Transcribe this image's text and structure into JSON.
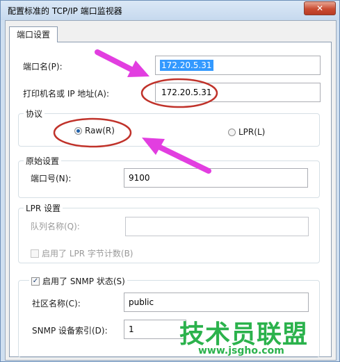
{
  "window": {
    "title": "配置标准的 TCP/IP 端口监视器",
    "close_label": "✕"
  },
  "tabs": [
    {
      "label": "端口设置"
    }
  ],
  "port_name": {
    "label": "端口名(P):",
    "value": "172.20.5.31"
  },
  "printer_address": {
    "label": "打印机名或 IP 地址(A):",
    "value": "172.20.5.31"
  },
  "protocol": {
    "title": "协议",
    "options": [
      {
        "label": "Raw(R)",
        "selected": true
      },
      {
        "label": "LPR(L)",
        "selected": false
      }
    ]
  },
  "raw_settings": {
    "title": "原始设置",
    "port_number_label": "端口号(N):",
    "port_number_value": "9100"
  },
  "lpr_settings": {
    "title": "LPR 设置",
    "queue_name_label": "队列名称(Q):",
    "queue_name_value": "",
    "byte_counting_label": "启用了 LPR 字节计数(B)",
    "byte_counting_checked": false
  },
  "snmp": {
    "enabled_label": "启用了 SNMP 状态(S)",
    "enabled_checked": true,
    "community_label": "社区名称(C):",
    "community_value": "public",
    "device_index_label": "SNMP 设备索引(D):",
    "device_index_value": "1"
  },
  "watermark": {
    "brand_text": "技术员联盟",
    "url": "www.jsgho.com"
  },
  "colors": {
    "annotation_arrow": "#e23ee0",
    "annotation_ellipse": "#c0322a",
    "watermark": "#2bb24c"
  }
}
